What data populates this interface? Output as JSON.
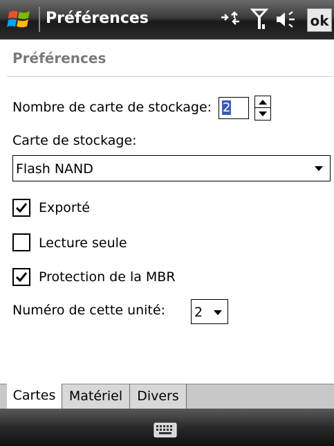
{
  "titlebar": {
    "title": "Préférences",
    "ok_label": "ok",
    "icons": [
      "windows-start-icon",
      "connectivity-icon",
      "signal-icon",
      "volume-icon"
    ]
  },
  "page": {
    "header": "Préférences"
  },
  "form": {
    "storage_count_label": "Nombre de carte de stockage:",
    "storage_count_value": "2",
    "storage_card_label": "Carte de stockage:",
    "storage_card_value": "Flash NAND",
    "exported_label": "Exporté",
    "exported_checked": true,
    "readonly_label": "Lecture seule",
    "readonly_checked": false,
    "mbr_label": "Protection de la MBR",
    "mbr_checked": true,
    "unit_number_label": "Numéro de cette unité:",
    "unit_number_value": "2"
  },
  "tabs": [
    {
      "label": "Cartes",
      "active": true
    },
    {
      "label": "Matériel",
      "active": false
    },
    {
      "label": "Divers",
      "active": false
    }
  ],
  "softkeys": {
    "center_icon": "keyboard-icon"
  },
  "colors": {
    "titlebar": "#2a2a2a",
    "header_text": "#7a7a7a",
    "selection": "#3b5bb5"
  }
}
